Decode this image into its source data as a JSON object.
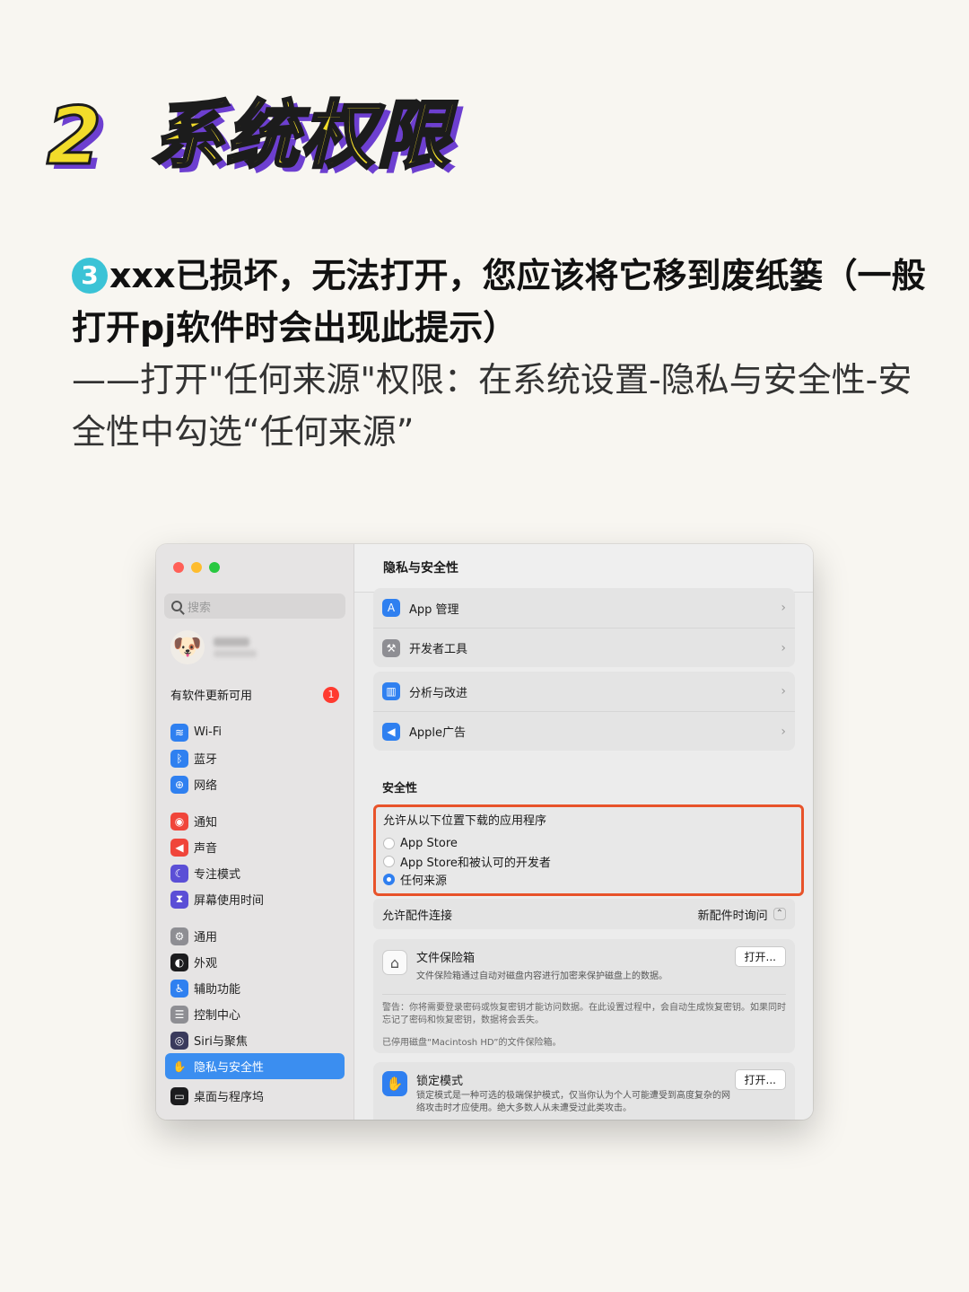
{
  "hero": {
    "number": "2",
    "title": "系统权限"
  },
  "intro": {
    "step": "3",
    "bold": "xxx已损坏，无法打开，您应该将它移到废纸篓（一般打开pj软件时会出现此提示）",
    "light": "——打开\"任何来源\"权限：在系统设置-隐私与安全性-安全性中勾选“任何来源”"
  },
  "window": {
    "sidebar": {
      "search_placeholder": "搜索",
      "update_label": "有软件更新可用",
      "update_count": "1",
      "groups": [
        [
          {
            "label": "Wi-Fi",
            "icon": "wifi-icon",
            "color": "#2f80f0",
            "glyph": "≋"
          },
          {
            "label": "蓝牙",
            "icon": "bluetooth-icon",
            "color": "#2f80f0",
            "glyph": "ᛒ"
          },
          {
            "label": "网络",
            "icon": "globe-icon",
            "color": "#2f80f0",
            "glyph": "⊕"
          }
        ],
        [
          {
            "label": "通知",
            "icon": "bell-icon",
            "color": "#f0453a",
            "glyph": "◉"
          },
          {
            "label": "声音",
            "icon": "speaker-icon",
            "color": "#f0453a",
            "glyph": "◀"
          },
          {
            "label": "专注模式",
            "icon": "moon-icon",
            "color": "#5b4fd6",
            "glyph": "☾"
          },
          {
            "label": "屏幕使用时间",
            "icon": "hourglass-icon",
            "color": "#5b4fd6",
            "glyph": "⧗"
          }
        ],
        [
          {
            "label": "通用",
            "icon": "gear-icon",
            "color": "#8e8e93",
            "glyph": "⚙"
          },
          {
            "label": "外观",
            "icon": "appearance-icon",
            "color": "#1c1c1e",
            "glyph": "◐"
          },
          {
            "label": "辅助功能",
            "icon": "accessibility-icon",
            "color": "#2f80f0",
            "glyph": "♿"
          },
          {
            "label": "控制中心",
            "icon": "control-center-icon",
            "color": "#8e8e93",
            "glyph": "☰"
          },
          {
            "label": "Siri与聚焦",
            "icon": "siri-icon",
            "color": "#3a3a5c",
            "glyph": "◎"
          },
          {
            "label": "隐私与安全性",
            "icon": "hand-icon",
            "color": "#3b8ef0",
            "glyph": "✋",
            "active": true
          }
        ],
        [
          {
            "label": "桌面与程序坞",
            "icon": "dock-icon",
            "color": "#1c1c1e",
            "glyph": "▭"
          }
        ]
      ]
    },
    "main": {
      "title": "隐私与安全性",
      "group1": [
        {
          "label": "App 管理",
          "icon": "app-store-icon",
          "color": "#2f80f0",
          "glyph": "A"
        },
        {
          "label": "开发者工具",
          "icon": "hammer-icon",
          "color": "#8e8e93",
          "glyph": "⚒"
        }
      ],
      "group2": [
        {
          "label": "分析与改进",
          "icon": "chart-icon",
          "color": "#2f80f0",
          "glyph": "▥"
        },
        {
          "label": "Apple广告",
          "icon": "megaphone-icon",
          "color": "#2f80f0",
          "glyph": "◀"
        }
      ],
      "security_heading": "安全性",
      "allow_label": "允许从以下位置下载的应用程序",
      "radio_options": [
        {
          "label": "App Store",
          "selected": false
        },
        {
          "label": "App Store和被认可的开发者",
          "selected": false
        },
        {
          "label": "任何来源",
          "selected": true
        }
      ],
      "accessory_label": "允许配件连接",
      "accessory_value": "新配件时询问",
      "filevault": {
        "title": "文件保险箱",
        "desc": "文件保险箱通过自动对磁盘内容进行加密来保护磁盘上的数据。",
        "button": "打开...",
        "warning": "警告：你将需要登录密码或恢复密钥才能访问数据。在此设置过程中，会自动生成恢复密钥。如果同时忘记了密码和恢复密钥，数据将会丢失。",
        "disk_note": "已停用磁盘“Macintosh HD”的文件保险箱。"
      },
      "lockdown": {
        "title": "锁定模式",
        "desc": "锁定模式是一种可选的极端保护模式，仅当你认为个人可能遭受到高度复杂的网络攻击时才应使用。绝大多数人从未遭受过此类攻击。",
        "button": "打开..."
      }
    }
  }
}
